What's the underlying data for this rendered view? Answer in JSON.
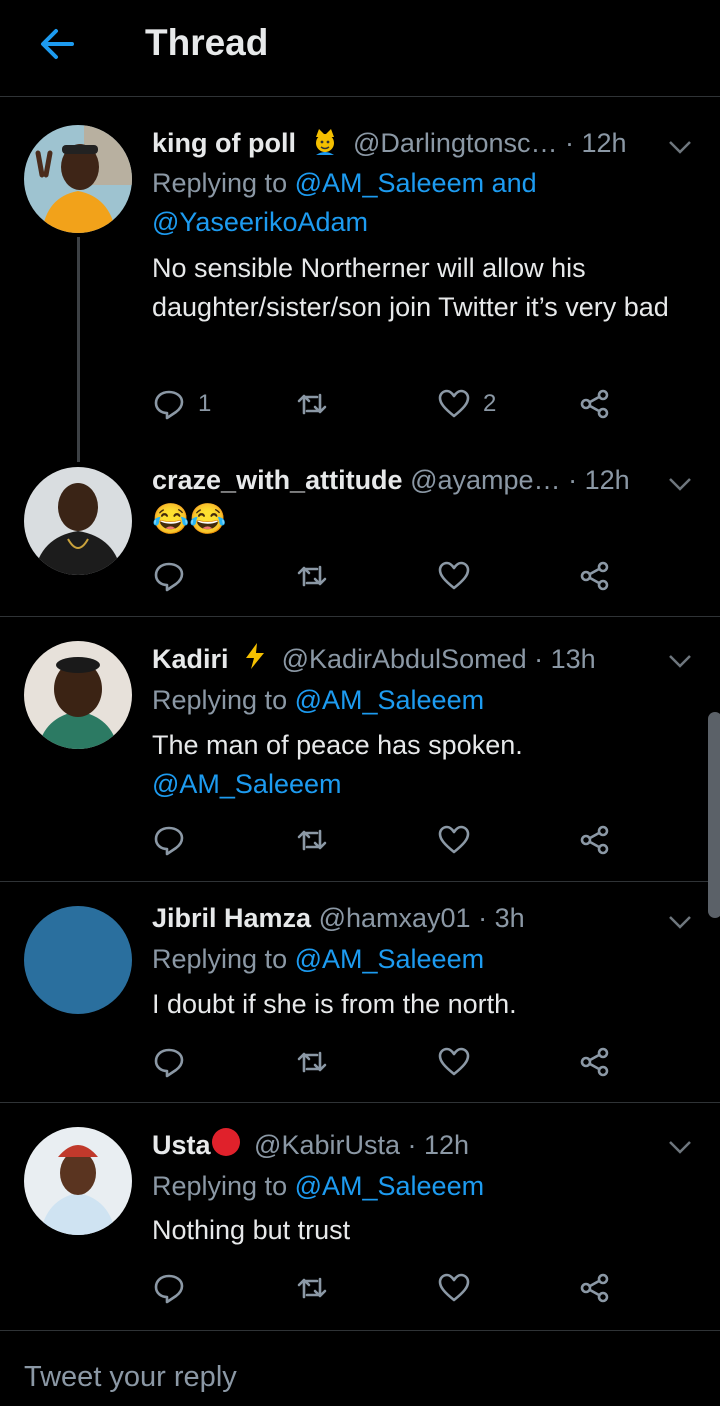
{
  "header": {
    "title": "Thread"
  },
  "tweets": [
    {
      "name": "king of poll",
      "badge": "prince-emoji",
      "handle": "@Darlingtonsc…",
      "time": "· 12h",
      "replying_prefix": "Replying to ",
      "replying_to": "@AM_Saleeem and @YaseerikoAdam",
      "text": "No sensible Northerner will allow his daughter/sister/son join Twitter it’s very bad",
      "reply_count": "1",
      "like_count": "2"
    },
    {
      "name": "craze_with_attitude",
      "handle": "@ayampe…",
      "time": "· 12h",
      "text_emoji": "😂😂"
    },
    {
      "name": "Kadiri",
      "badge": "lightning-emoji",
      "handle": "@KadirAbdulSomed",
      "time": "· 13h",
      "replying_prefix": "Replying to ",
      "replying_to": "@AM_Saleeem",
      "text": "The man of peace has spoken.",
      "mention": "@AM_Saleeem"
    },
    {
      "name": "Jibril Hamza",
      "handle": "@hamxay01",
      "time": "· 3h",
      "replying_prefix": "Replying to ",
      "replying_to": "@AM_Saleeem",
      "text": "I doubt if she is from the north."
    },
    {
      "name": "Usta",
      "badge": "red-circle-emoji",
      "handle": "@KabirUsta",
      "time": "· 12h",
      "replying_prefix": "Replying to ",
      "replying_to": "@AM_Saleeem",
      "text": "Nothing but trust"
    }
  ],
  "reply_bar": {
    "placeholder": "Tweet your reply"
  },
  "colors": {
    "background": "#000000",
    "accent": "#1d9bf0",
    "muted": "#8b98a5",
    "text": "#e7e9ea",
    "divider": "#2f3336"
  }
}
